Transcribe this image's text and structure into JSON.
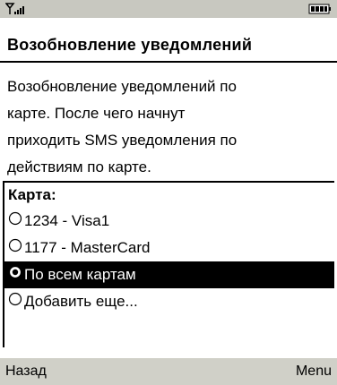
{
  "status": {
    "signal_icon": "signal-antenna-icon",
    "battery_icon": "battery-icon"
  },
  "title": "Возобновление уведомлений",
  "description": "Возобновление уведомлений по\nкарте. После чего начнут\nприходить SMS уведомления по\nдействиям по карте.",
  "card_group": {
    "label": "Карта:",
    "options": [
      {
        "label": "1234 - Visa1",
        "selected": false
      },
      {
        "label": "1177 - MasterCard",
        "selected": false
      },
      {
        "label": "По всем картам",
        "selected": true
      },
      {
        "label": "Добавить еще...",
        "selected": false
      }
    ]
  },
  "softkeys": {
    "left": "Назад",
    "right": "Menu"
  },
  "colors": {
    "selected_bg": "#000000",
    "selected_fg": "#ffffff",
    "statusbar_bg": "#c8c8c0",
    "softkeys_bg": "#d0d0c8"
  }
}
